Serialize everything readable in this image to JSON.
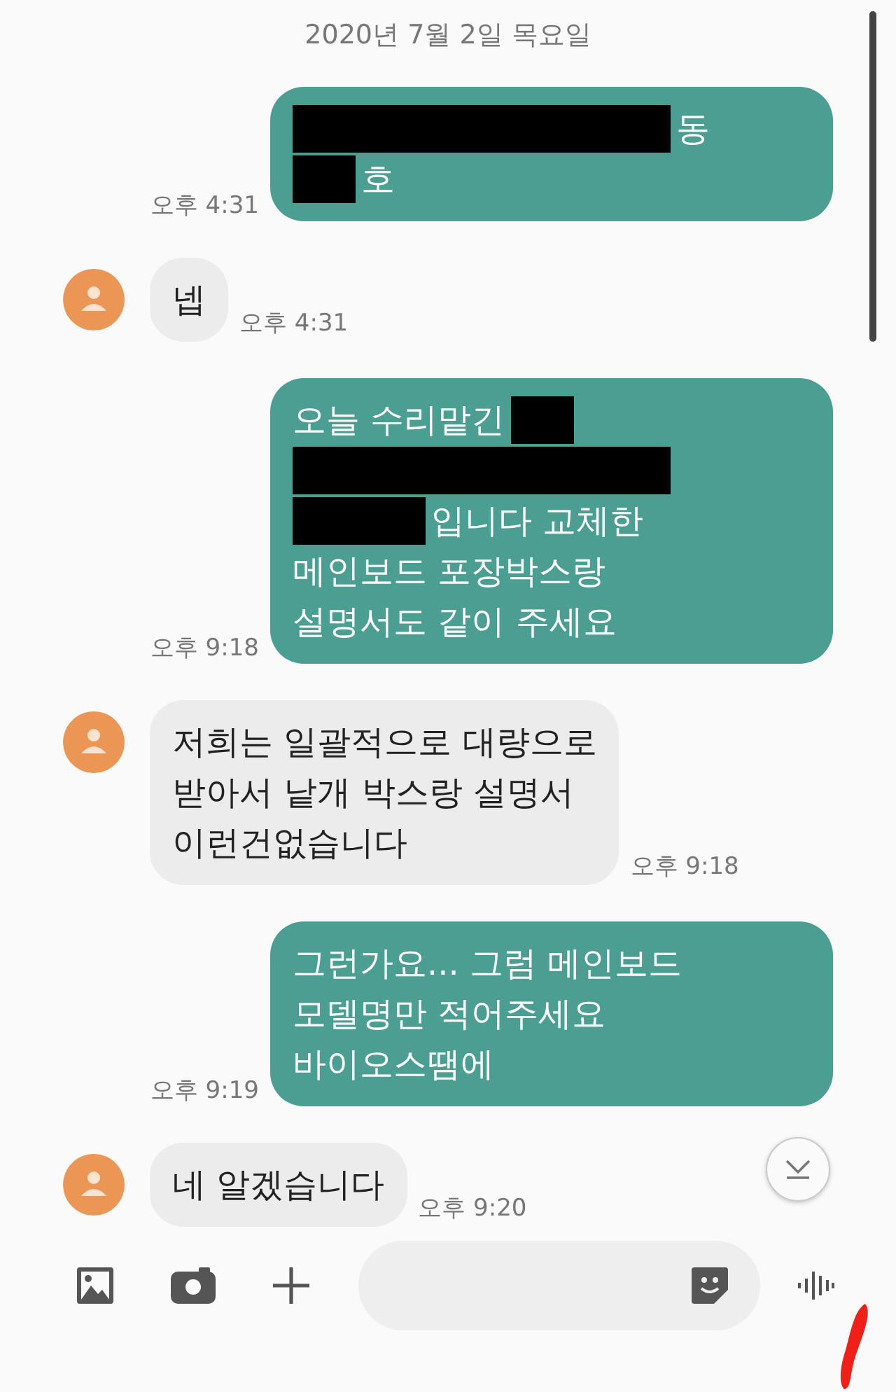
{
  "date_header": "2020년 7월 2일 목요일",
  "messages": [
    {
      "kind": "outgoing",
      "time": "오후 4:31",
      "lines": [
        [
          {
            "kind": "redaction_long"
          },
          {
            "kind": "text",
            "text": "동"
          }
        ],
        [
          {
            "kind": "redaction_short"
          },
          {
            "kind": "text",
            "text": "호"
          }
        ]
      ]
    },
    {
      "kind": "incoming",
      "time": "오후 4:31",
      "lines": [
        [
          {
            "kind": "text",
            "text": "넵"
          }
        ]
      ]
    },
    {
      "kind": "outgoing",
      "time": "오후 9:18",
      "lines": [
        [
          {
            "kind": "text",
            "text": "오늘 수리맡긴"
          },
          {
            "kind": "redaction_short"
          }
        ],
        [
          {
            "kind": "redaction_long"
          }
        ],
        [
          {
            "kind": "redaction_medium"
          },
          {
            "kind": "text",
            "text": "입니다 교체한"
          }
        ],
        [
          {
            "kind": "text",
            "text": "메인보드 포장박스랑"
          }
        ],
        [
          {
            "kind": "text",
            "text": "설명서도 같이 주세요"
          }
        ]
      ]
    },
    {
      "kind": "incoming",
      "time": "오후 9:18",
      "lines": [
        [
          {
            "kind": "text",
            "text": "저희는 일괄적으로 대량으로"
          }
        ],
        [
          {
            "kind": "text",
            "text": "받아서 낱개 박스랑 설명서"
          }
        ],
        [
          {
            "kind": "text",
            "text": "이런건없습니다"
          }
        ]
      ]
    },
    {
      "kind": "outgoing",
      "time": "오후 9:19",
      "lines": [
        [
          {
            "kind": "text",
            "text": "그런가요... 그럼 메인보드"
          }
        ],
        [
          {
            "kind": "text",
            "text": "모델명만 적어주세요"
          }
        ],
        [
          {
            "kind": "text",
            "text": "바이오스땜에"
          }
        ]
      ]
    },
    {
      "kind": "incoming",
      "time": "오후 9:20",
      "lines": [
        [
          {
            "kind": "text",
            "text": "네 알겠습니다"
          }
        ]
      ]
    }
  ]
}
